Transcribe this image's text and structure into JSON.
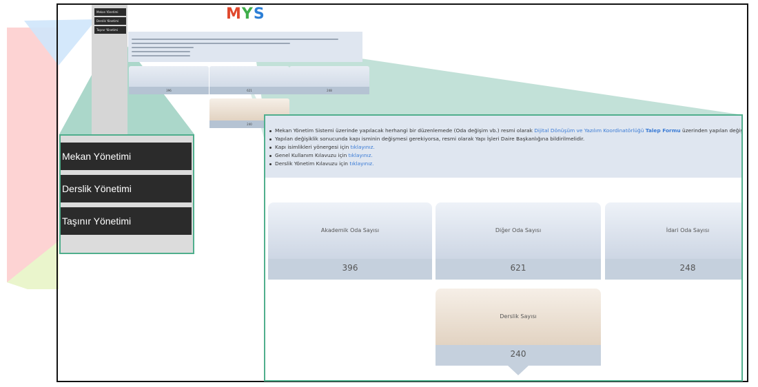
{
  "sidebar": {
    "items": [
      {
        "label": "Mekan Yönetimi"
      },
      {
        "label": "Derslik Yönetimi"
      },
      {
        "label": "Taşınır Yönetimi"
      }
    ]
  },
  "logo": {
    "letters": [
      "M",
      "Y",
      "S"
    ],
    "colors": [
      "#e0482d",
      "#3fae4a",
      "#2d7fd6"
    ]
  },
  "notices": {
    "item1": {
      "text": "Mekan Yönetim Sistemi üzerinde yapılacak herhangi bir düzenlemede (Oda değişim vb.) resmi olarak ",
      "link1": "Dijital Dönüşüm ve Yazılım Koordinatörlüğü",
      "link2": "Talep Formu",
      "tail": " üzerinden yapılan değişiklik bildirilmelidir."
    },
    "item2": {
      "text": "Yapılan değişiklik sonucunda kapı isminin değişmesi gerekiyorsa, resmi olarak Yapı İşleri Daire Başkanlığına bildirilmelidir."
    },
    "item3": {
      "text": "Kapı isimlikleri yönergesi için ",
      "link": "tıklayınız."
    },
    "item4": {
      "text": "Genel Kullanım Kılavuzu için ",
      "link": "tıklayınız."
    },
    "item5": {
      "text": "Derslik Yönetim Kılavuzu için ",
      "link": "tıklayınız."
    }
  },
  "stats": {
    "akademik": {
      "label": "Akademik Oda Sayısı",
      "value": "396"
    },
    "diger": {
      "label": "Diğer Oda Sayısı",
      "value": "621"
    },
    "idari": {
      "label": "İdari Oda Sayısı",
      "value": "248"
    },
    "derslik": {
      "label": "Derslik Sayısı",
      "value": "240"
    }
  },
  "colors": {
    "accent_border": "#4fae8c",
    "menu_bg": "#2b2b2b",
    "link": "#3a7bd5"
  }
}
